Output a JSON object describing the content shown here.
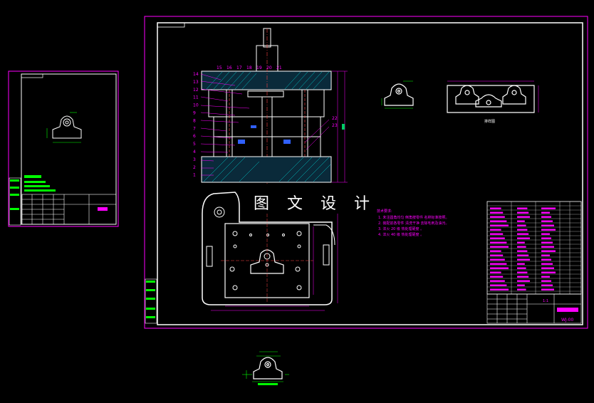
{
  "watermark": "图 文 设 计",
  "tech_title": "技术要求:",
  "tech_notes": [
    "1. 未注圆角均匀 倒角按零件 名称标准按照。",
    "2. 装配前各零件 清洗干净 去除毛刺及油污。",
    "3. 淬火 20 级 热处理硬度 。",
    "4. 淬火 40 级 热处理硬度 。"
  ],
  "part_numbers_left": [
    "14",
    "13",
    "12",
    "11",
    "10",
    "9",
    "8",
    "7",
    "6",
    "5",
    "4",
    "3",
    "2",
    "1"
  ],
  "part_numbers_top": [
    "15",
    "16",
    "17",
    "18",
    "19",
    "20",
    "21"
  ],
  "part_numbers_right": [
    "22",
    "23"
  ],
  "view_label": "排样图",
  "title_block": {
    "scale": "1:1",
    "code": "WJ-00"
  },
  "colors": {
    "frame": "#ff00ff",
    "line": "#ffffff",
    "accent": "#00ff00",
    "hatch": "#00ffff",
    "dim": "#ff00ff"
  }
}
